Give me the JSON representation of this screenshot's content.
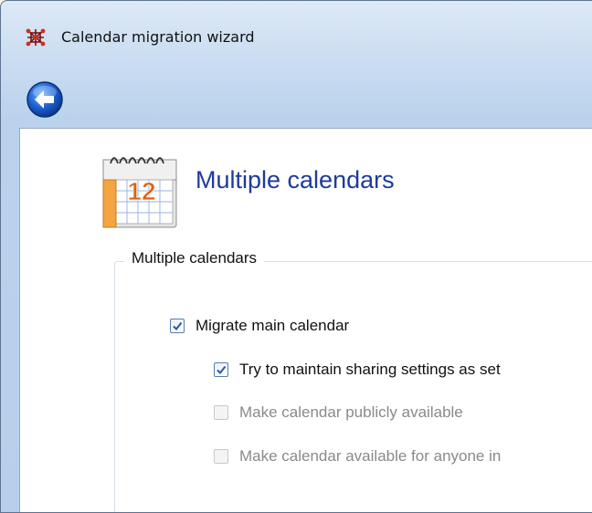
{
  "window": {
    "title": "Calendar migration wizard",
    "app_icon": "network-nodes-icon"
  },
  "nav": {
    "back_icon": "back-arrow-icon"
  },
  "page": {
    "header_icon": "calendar-icon",
    "calendar_icon_day": "12",
    "title": "Multiple calendars"
  },
  "group": {
    "legend": "Multiple calendars",
    "options": [
      {
        "label": "Migrate main calendar",
        "checked": true,
        "enabled": true
      },
      {
        "label": "Try to maintain sharing settings as set",
        "checked": true,
        "enabled": true
      },
      {
        "label": "Make calendar publicly available",
        "checked": false,
        "enabled": false
      },
      {
        "label": "Make calendar available for anyone in",
        "checked": false,
        "enabled": false
      }
    ]
  },
  "colors": {
    "title_blue": "#1e3a9b",
    "chrome_blue": "#c9dcf1",
    "check_blue": "#2b56a8",
    "disabled_text": "#8a8a8a"
  }
}
